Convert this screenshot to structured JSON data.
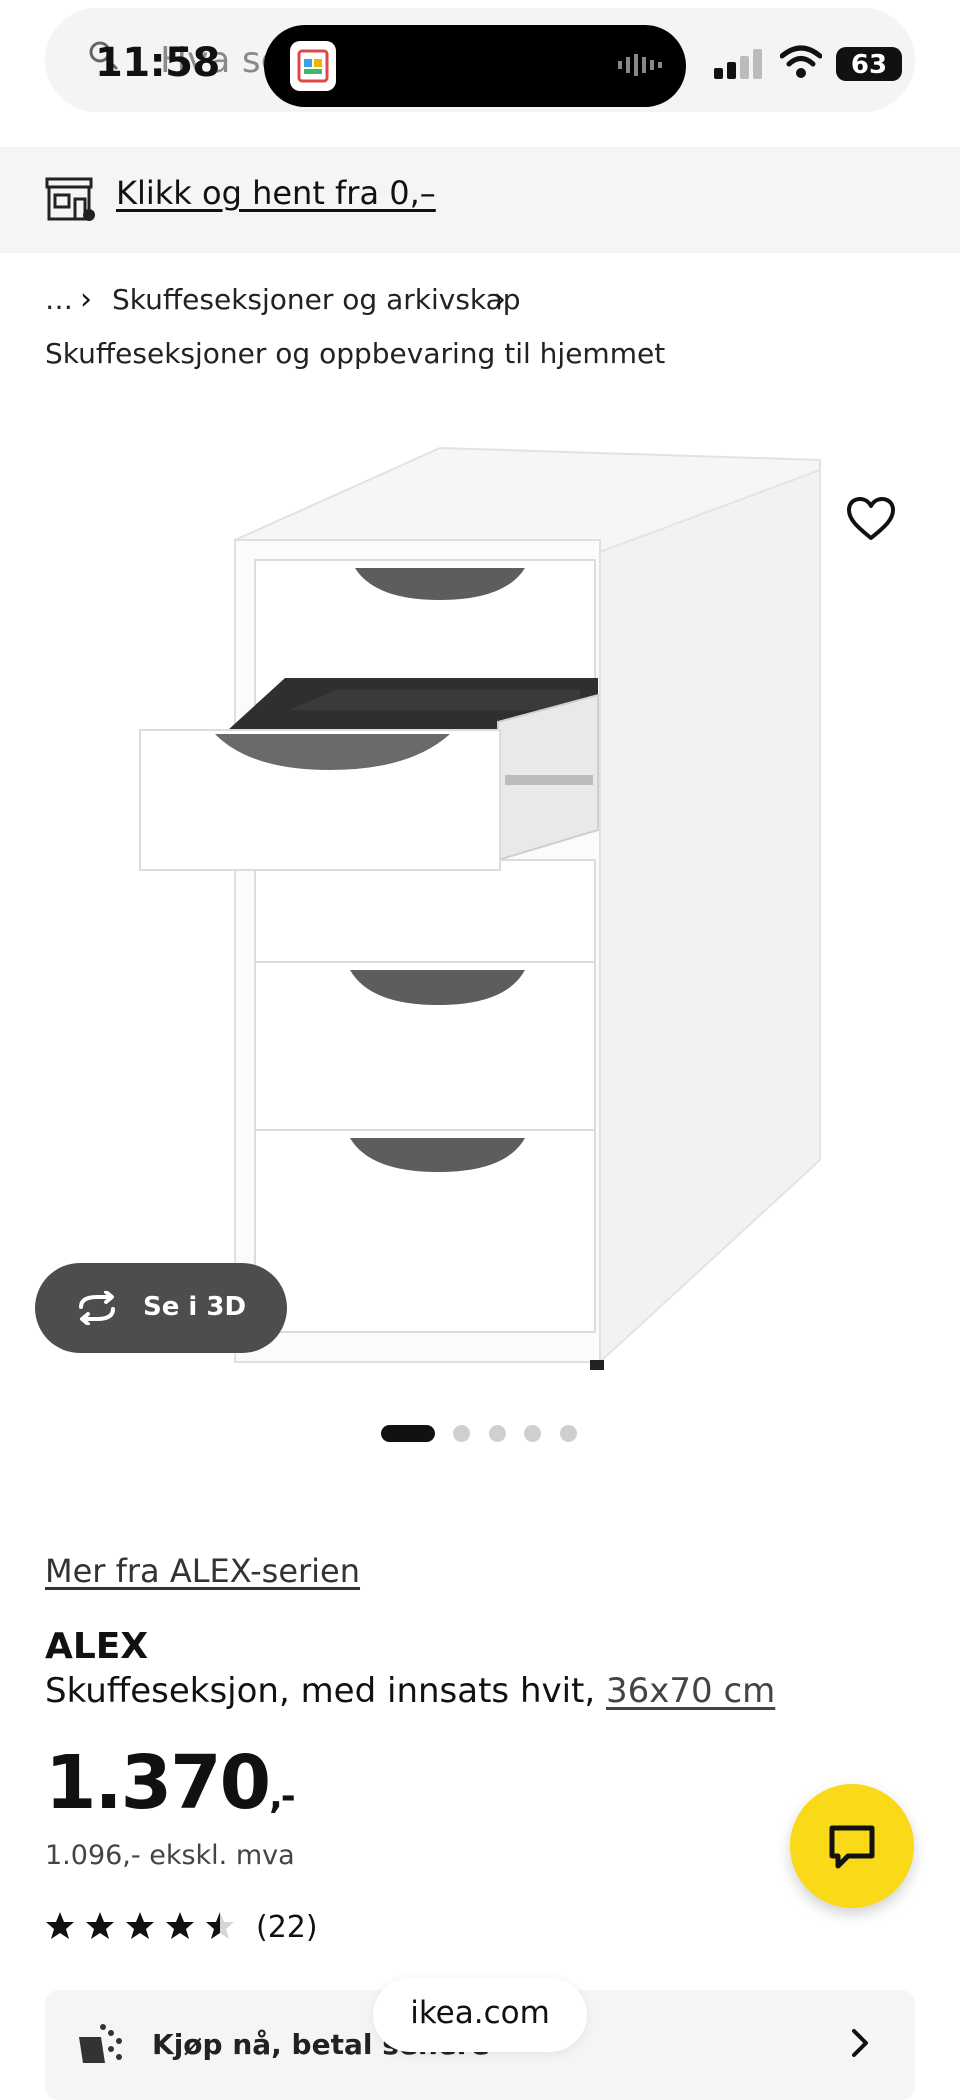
{
  "status_bar": {
    "time": "11:58",
    "battery": "63"
  },
  "search": {
    "placeholder": "Hva se"
  },
  "pickup_banner": {
    "label": "Klikk og hent fra 0,–"
  },
  "breadcrumb": {
    "ellipsis": "…",
    "items": [
      "Skuffeseksjoner og arkivskap",
      "Skuffeseksjoner og oppbevaring til hjemmet"
    ]
  },
  "gallery": {
    "view_3d_label": "Se i 3D",
    "total_images": 5,
    "active_index": 0
  },
  "product": {
    "series_link": "Mer fra ALEX-serien",
    "name": "ALEX",
    "description": "Skuffeseksjon, med innsats hvit, ",
    "size": "36x70 cm",
    "price": "1.370",
    "price_suffix": ",-",
    "price_ex_vat": "1.096,- ekskl. mva",
    "rating": 4.5,
    "rating_max": 5,
    "review_count": "(22)"
  },
  "payment": {
    "label": "Kjøp nå, betal senere"
  },
  "browser": {
    "url": "ikea.com"
  },
  "colors": {
    "brand_yellow": "#fad919",
    "text": "#111111",
    "banner_bg": "#f5f5f5",
    "button_dark": "#4d4d4d"
  },
  "icons": [
    "search-icon",
    "store-icon",
    "heart-icon",
    "rotate-3d-icon",
    "chat-icon",
    "star-icon",
    "payment-icon",
    "chevron-right-icon"
  ]
}
